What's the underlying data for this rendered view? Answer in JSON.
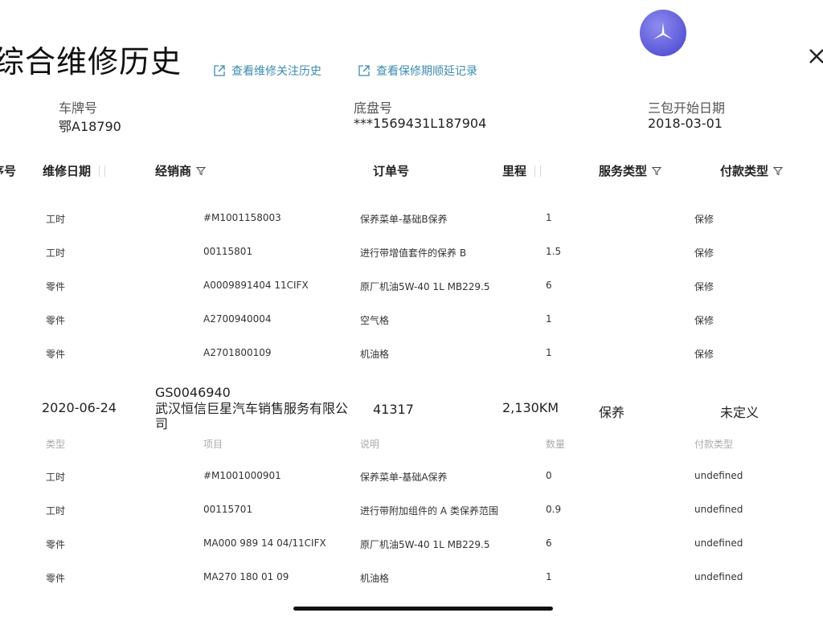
{
  "page": {
    "title": "综合维修历史",
    "links": [
      "查看维修关注历史",
      "查看保修期顺延记录"
    ]
  },
  "vehicle": {
    "plate_label": "车牌号",
    "plate_value": "鄂A18790",
    "chassis_label": "底盘号",
    "chassis_value": "***1569431L187904",
    "warranty_label": "三包开始日期",
    "warranty_value": "2018-03-01"
  },
  "table": {
    "columns": [
      "序号",
      "维修日期",
      "经销商",
      "订单号",
      "里程",
      "服务类型",
      "付款类型"
    ],
    "group1_items": [
      {
        "type": "工时",
        "item": "#M1001158003",
        "desc": "保养菜单-基础B保养",
        "qty": "1",
        "pay": "保修"
      },
      {
        "type": "工时",
        "item": "00115801",
        "desc": "进行带增值套件的保养 B",
        "qty": "1.5",
        "pay": "保修"
      },
      {
        "type": "零件",
        "item": "A0009891404 11CIFX",
        "desc": "原厂机油5W-40 1L MB229.5",
        "qty": "6",
        "pay": "保修"
      },
      {
        "type": "零件",
        "item": "A2700940004",
        "desc": "空气格",
        "qty": "1",
        "pay": "保修"
      },
      {
        "type": "零件",
        "item": "A2701800109",
        "desc": "机油格",
        "qty": "1",
        "pay": "保修"
      }
    ],
    "record2": {
      "date": "2020-06-24",
      "dealer_code": "GS0046940",
      "dealer_name": "武汉恒信巨星汽车销售服务有限公司",
      "order": "41317",
      "mileage": "2,130KM",
      "service": "保养",
      "payment": "未定义"
    },
    "sub_headers": [
      "类型",
      "项目",
      "说明",
      "数量",
      "付款类型"
    ],
    "group2_items": [
      {
        "type": "工时",
        "item": "#M1001000901",
        "desc": "保养菜单-基础A保养",
        "qty": "0",
        "pay": "undefined"
      },
      {
        "type": "工时",
        "item": "00115701",
        "desc": "进行带附加组件的 A 类保养范围",
        "qty": "0.9",
        "pay": "undefined"
      },
      {
        "type": "零件",
        "item": "MA000 989 14 04/11CIFX",
        "desc": "原厂机油5W-40 1L MB229.5",
        "qty": "6",
        "pay": "undefined"
      },
      {
        "type": "零件",
        "item": "MA270 180 01 09",
        "desc": "机油格",
        "qty": "1",
        "pay": "undefined"
      }
    ]
  },
  "icons": {
    "logo": "mercedes-star-icon",
    "close": "close-icon",
    "external": "external-link-icon",
    "filter": "filter-icon",
    "sort": "sort-handle-icon"
  },
  "colors": {
    "link": "#3d8bb0",
    "logo": "#5b58d8"
  }
}
